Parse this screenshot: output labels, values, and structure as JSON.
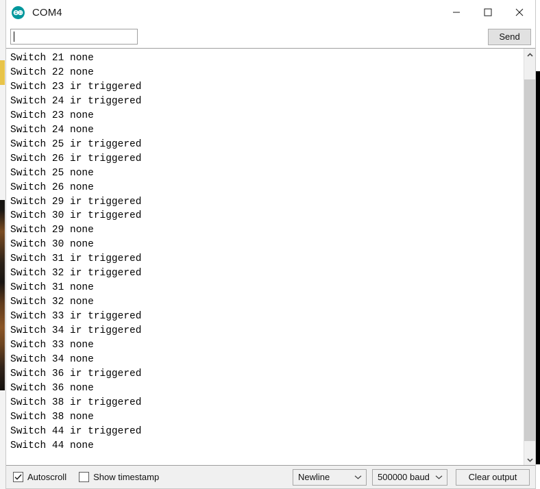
{
  "window": {
    "title": "COM4",
    "logo_icon": "arduino-logo-icon",
    "controls": {
      "minimize": "minimize-icon",
      "maximize": "maximize-icon",
      "close": "close-icon"
    }
  },
  "send_bar": {
    "input_value": "",
    "input_placeholder": "",
    "send_label": "Send"
  },
  "console": {
    "lines": [
      "Switch 21 none",
      "Switch 22 none",
      "Switch 23 ir triggered",
      "Switch 24 ir triggered",
      "Switch 23 none",
      "Switch 24 none",
      "Switch 25 ir triggered",
      "Switch 26 ir triggered",
      "Switch 25 none",
      "Switch 26 none",
      "Switch 29 ir triggered",
      "Switch 30 ir triggered",
      "Switch 29 none",
      "Switch 30 none",
      "Switch 31 ir triggered",
      "Switch 32 ir triggered",
      "Switch 31 none",
      "Switch 32 none",
      "Switch 33 ir triggered",
      "Switch 34 ir triggered",
      "Switch 33 none",
      "Switch 34 none",
      "Switch 36 ir triggered",
      "Switch 36 none",
      "Switch 38 ir triggered",
      "Switch 38 none",
      "Switch 44 ir triggered",
      "Switch 44 none"
    ]
  },
  "scrollbar": {
    "up_icon": "chevron-up-icon",
    "down_icon": "chevron-down-icon"
  },
  "status_bar": {
    "autoscroll": {
      "label": "Autoscroll",
      "checked": true
    },
    "show_timestamp": {
      "label": "Show timestamp",
      "checked": false
    },
    "line_ending": {
      "value": "Newline",
      "arrow_icon": "chevron-down-icon"
    },
    "baud_rate": {
      "value": "500000 baud",
      "arrow_icon": "chevron-down-icon"
    },
    "clear_output_label": "Clear output"
  },
  "colors": {
    "accent": "#00979c",
    "titlebar_bg": "#ffffff",
    "statusbar_bg": "#f0f0f0",
    "console_bg": "#ffffff",
    "console_text": "#000000"
  }
}
